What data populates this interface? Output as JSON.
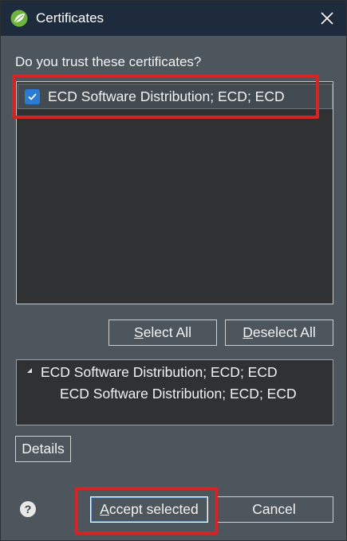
{
  "window": {
    "title": "Certificates",
    "colors": {
      "titlebar": "#1e2b3d",
      "body": "#4e565d",
      "highlight": "#d42424",
      "checkbox": "#2a7bd6"
    }
  },
  "prompt": "Do you trust these certificates?",
  "certificates": [
    {
      "label": "ECD Software Distribution; ECD; ECD",
      "checked": true
    }
  ],
  "buttons": {
    "select_all": {
      "mnemonic": "S",
      "rest": "elect All"
    },
    "deselect_all": {
      "mnemonic": "D",
      "rest": "eselect All"
    },
    "details": "Details",
    "accept": {
      "mnemonic": "A",
      "rest": "ccept selected"
    },
    "cancel": "Cancel"
  },
  "tree": {
    "root": "ECD Software Distribution; ECD; ECD",
    "child": "ECD Software Distribution; ECD; ECD"
  },
  "help_glyph": "?"
}
